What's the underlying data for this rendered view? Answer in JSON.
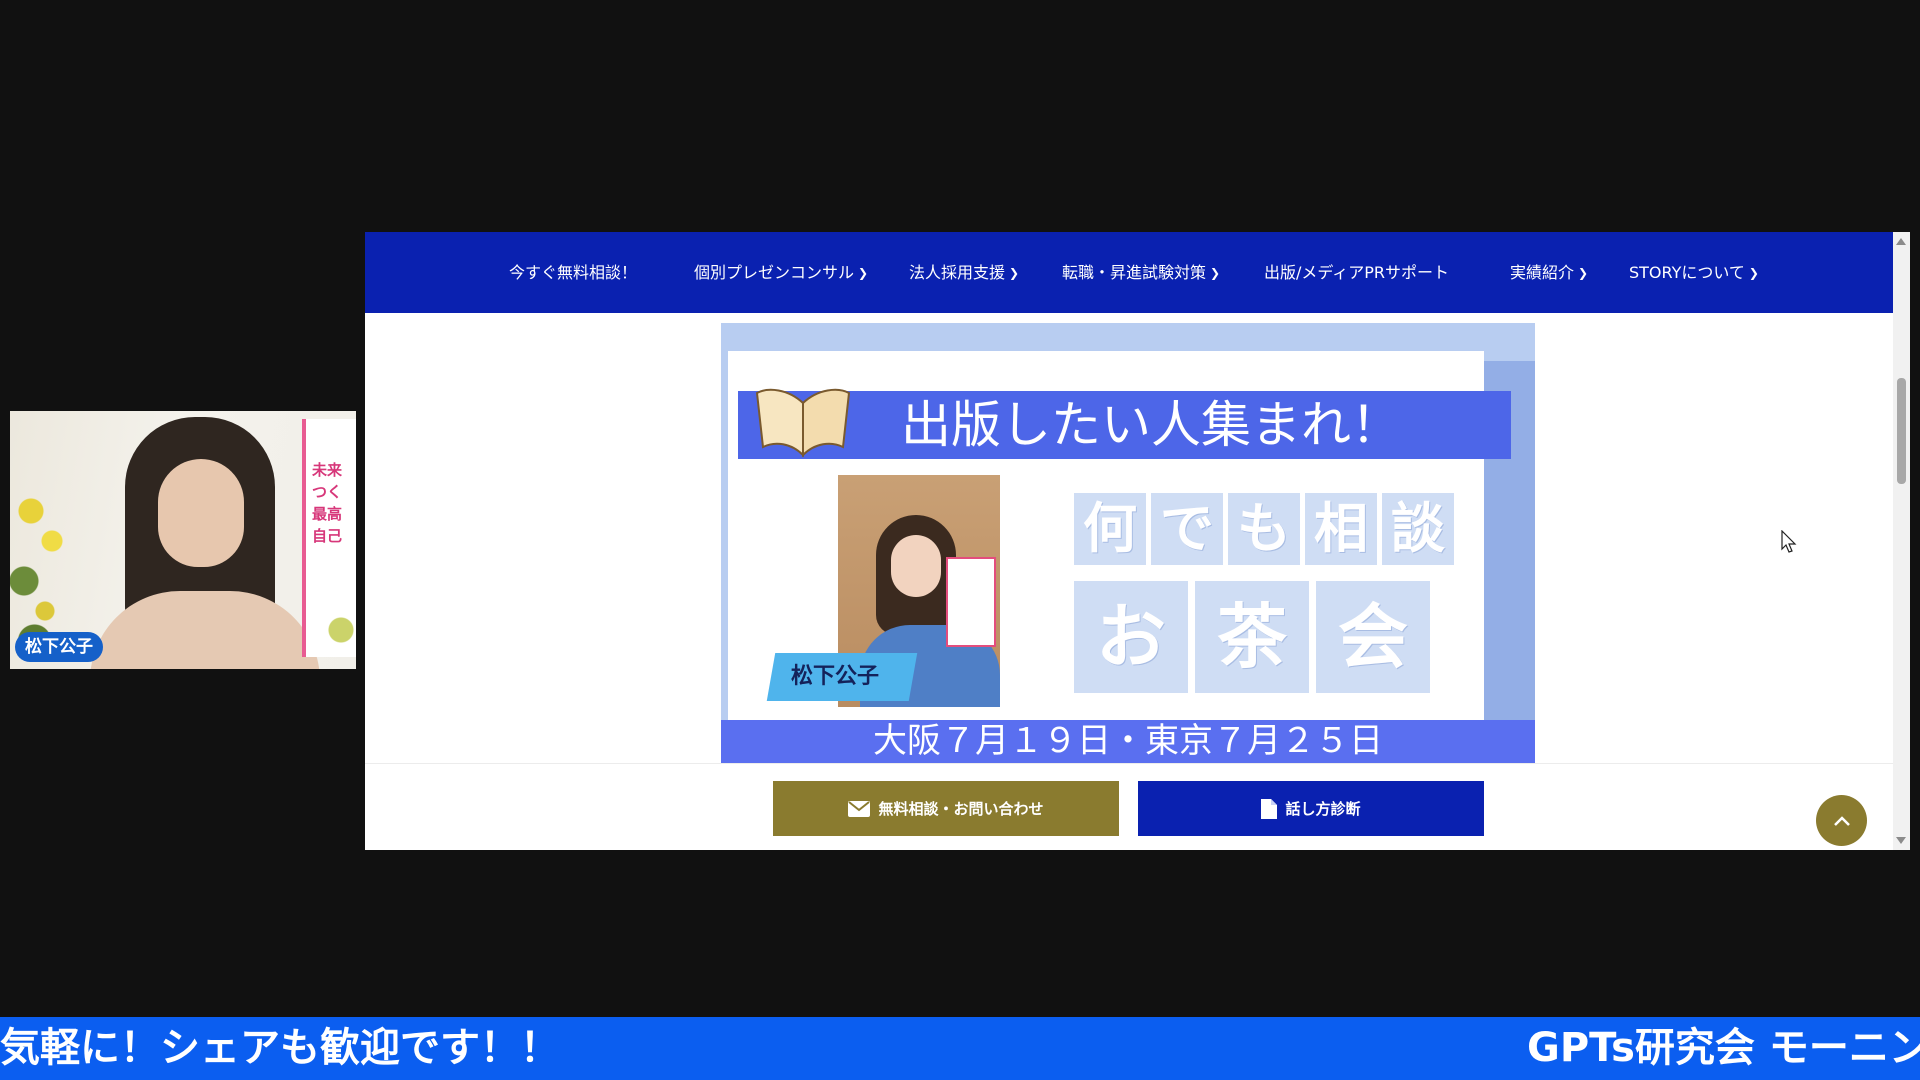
{
  "webcam": {
    "participant_name": "松下公子",
    "book_text_lines": [
      "未来",
      "つく",
      "最高",
      "自己"
    ]
  },
  "site": {
    "nav": [
      {
        "label": "今すぐ無料相談！",
        "has_dropdown": false
      },
      {
        "label": "個別プレゼンコンサル",
        "has_dropdown": true
      },
      {
        "label": "法人採用支援",
        "has_dropdown": true
      },
      {
        "label": "転職・昇進試験対策",
        "has_dropdown": true
      },
      {
        "label": "出版/メディアPRサポート",
        "has_dropdown": false
      },
      {
        "label": "実績紹介",
        "has_dropdown": true
      },
      {
        "label": "STORYについて",
        "has_dropdown": true
      }
    ],
    "banner": {
      "headline": "出版したい人集まれ！",
      "name_tag": "松下公子",
      "tiles_row1": [
        "何",
        "で",
        "も",
        "相",
        "談"
      ],
      "tiles_row2": [
        "お",
        "茶",
        "会"
      ],
      "dates": "大阪７月１９日・東京７月２５日"
    },
    "cta": {
      "contact_label": "無料相談・お問い合わせ",
      "diagnosis_label": "話し方診断"
    },
    "colors": {
      "nav_bg": "#0a21b0",
      "contact_button": "#8a7b2f",
      "diagnosis_button": "#0a21b0",
      "banner_ribbon": "#4d66e8"
    }
  },
  "ticker": {
    "left_text": "気軽に！シェアも歓迎です！！",
    "right_text": "GPTs研究会 モーニング"
  },
  "icons": {
    "dropdown": "chevron-down-icon",
    "contact": "envelope-icon",
    "diagnosis": "document-icon",
    "back_to_top": "chevron-up-icon",
    "pointer": "mouse-cursor-icon"
  }
}
